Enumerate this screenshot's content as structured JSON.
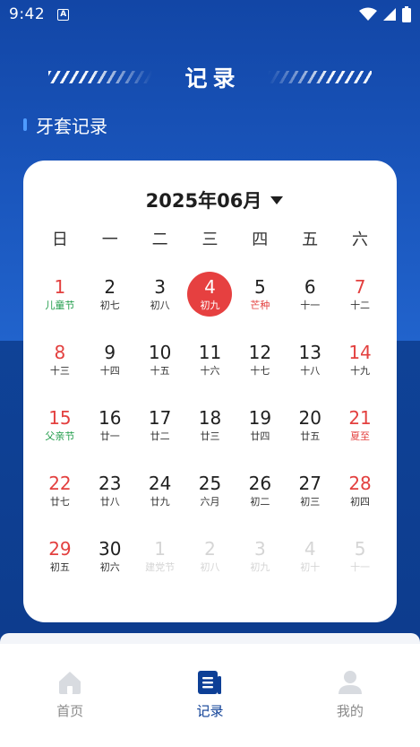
{
  "status_bar": {
    "time": "9:42",
    "notification_letter": "A"
  },
  "header": {
    "title": "记录",
    "section_title": "牙套记录"
  },
  "calendar": {
    "month_label": "2025年06月",
    "weekdays": [
      "日",
      "一",
      "二",
      "三",
      "四",
      "五",
      "六"
    ],
    "today_day": "4",
    "weeks": [
      [
        {
          "day": "1",
          "sub": "儿童节",
          "weekend": true,
          "festival": "green"
        },
        {
          "day": "2",
          "sub": "初七"
        },
        {
          "day": "3",
          "sub": "初八"
        },
        {
          "day": "4",
          "sub": "初九",
          "today": true
        },
        {
          "day": "5",
          "sub": "芒种",
          "festival": "red"
        },
        {
          "day": "6",
          "sub": "十一"
        },
        {
          "day": "7",
          "sub": "十二",
          "weekend": true
        }
      ],
      [
        {
          "day": "8",
          "sub": "十三",
          "weekend": true
        },
        {
          "day": "9",
          "sub": "十四"
        },
        {
          "day": "10",
          "sub": "十五"
        },
        {
          "day": "11",
          "sub": "十六"
        },
        {
          "day": "12",
          "sub": "十七"
        },
        {
          "day": "13",
          "sub": "十八"
        },
        {
          "day": "14",
          "sub": "十九",
          "weekend": true
        }
      ],
      [
        {
          "day": "15",
          "sub": "父亲节",
          "weekend": true,
          "festival": "green"
        },
        {
          "day": "16",
          "sub": "廿一"
        },
        {
          "day": "17",
          "sub": "廿二"
        },
        {
          "day": "18",
          "sub": "廿三"
        },
        {
          "day": "19",
          "sub": "廿四"
        },
        {
          "day": "20",
          "sub": "廿五"
        },
        {
          "day": "21",
          "sub": "夏至",
          "weekend": true,
          "festival": "red"
        }
      ],
      [
        {
          "day": "22",
          "sub": "廿七",
          "weekend": true
        },
        {
          "day": "23",
          "sub": "廿八"
        },
        {
          "day": "24",
          "sub": "廿九"
        },
        {
          "day": "25",
          "sub": "六月"
        },
        {
          "day": "26",
          "sub": "初二"
        },
        {
          "day": "27",
          "sub": "初三"
        },
        {
          "day": "28",
          "sub": "初四",
          "weekend": true
        }
      ],
      [
        {
          "day": "29",
          "sub": "初五",
          "weekend": true
        },
        {
          "day": "30",
          "sub": "初六"
        },
        {
          "day": "1",
          "sub": "建党节",
          "other": true
        },
        {
          "day": "2",
          "sub": "初八",
          "other": true
        },
        {
          "day": "3",
          "sub": "初九",
          "other": true
        },
        {
          "day": "4",
          "sub": "初十",
          "other": true
        },
        {
          "day": "5",
          "sub": "十一",
          "other": true
        }
      ]
    ]
  },
  "tabbar": {
    "items": [
      {
        "label": "首页",
        "icon": "home-icon",
        "active": false
      },
      {
        "label": "记录",
        "icon": "record-icon",
        "active": true
      },
      {
        "label": "我的",
        "icon": "profile-icon",
        "active": false
      }
    ]
  },
  "colors": {
    "accent": "#0d3f96",
    "weekend": "#e3403f",
    "festival_green": "#1e9b48",
    "today": "#e64040"
  }
}
